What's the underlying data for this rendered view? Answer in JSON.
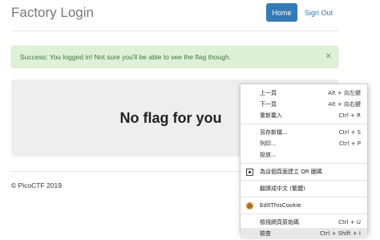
{
  "header": {
    "brand": "Factory Login",
    "nav": {
      "home": "Home",
      "signout": "Sign Out"
    }
  },
  "alert": {
    "message": "Success: You logged in! Not sure you'll be able to see the flag though.",
    "close": "×"
  },
  "jumbotron": {
    "heading": "No flag for you"
  },
  "footer": {
    "text": "© PicoCTF 2019"
  },
  "colors": {
    "primary": "#337ab7",
    "success_bg": "#dff0d8",
    "success_text": "#3c763d",
    "jumbotron_bg": "#eeeeee"
  },
  "context_menu": {
    "items": [
      {
        "label": "上一頁",
        "shortcut": "Alt + 向左鍵"
      },
      {
        "label": "下一頁",
        "shortcut": "Alt + 向右鍵"
      },
      {
        "label": "重新載入",
        "shortcut": "Ctrl + R"
      },
      {
        "label": "另存新檔...",
        "shortcut": "Ctrl + S"
      },
      {
        "label": "列印...",
        "shortcut": "Ctrl + P"
      },
      {
        "label": "投放...",
        "shortcut": ""
      },
      {
        "label": "為這個頁面建立 QR 圖碼",
        "shortcut": "",
        "icon": "qr-code-icon"
      },
      {
        "label": "翻譯成中文 (繁體)",
        "shortcut": ""
      },
      {
        "label": "EditThisCookie",
        "shortcut": "",
        "icon": "cookie-icon"
      },
      {
        "label": "檢視網頁原始碼",
        "shortcut": "Ctrl + U"
      },
      {
        "label": "檢查",
        "shortcut": "Ctrl + Shift + I"
      }
    ]
  }
}
